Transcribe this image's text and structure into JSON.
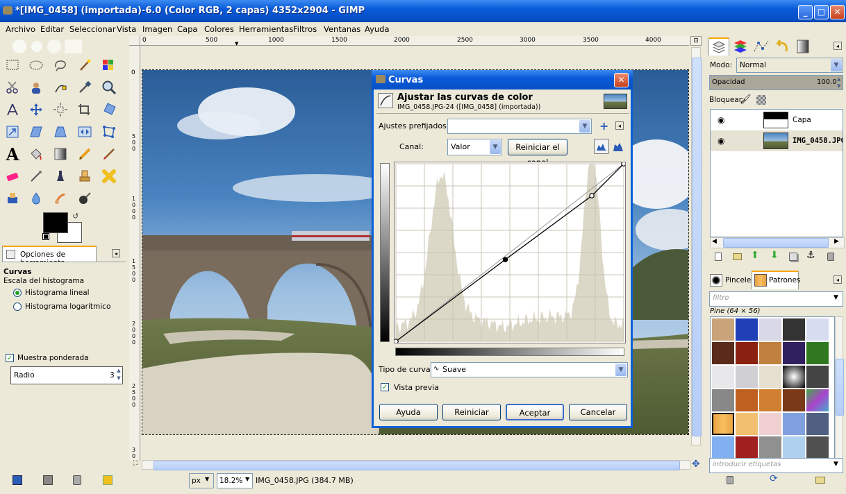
{
  "window": {
    "title": "*[IMG_0458] (importada)-6.0 (Color RGB, 2 capas) 4352x2904 - GIMP"
  },
  "menu": [
    "Archivo",
    "Editar",
    "Seleccionar",
    "Vista",
    "Imagen",
    "Capa",
    "Colores",
    "Herramientas",
    "Filtros",
    "Ventanas",
    "Ayuda"
  ],
  "ruler": {
    "top": [
      "0",
      "500",
      "1000",
      "1500",
      "2000",
      "2500",
      "3000",
      "3500",
      "4000"
    ],
    "left": [
      "0",
      "5 0 0",
      "1 0 0 0",
      "1 5 0 0",
      "2 0 0 0",
      "2 5 0 0",
      "3 0"
    ]
  },
  "tool_options": {
    "tab_label": "Opciones de herramienta",
    "heading": "Curvas",
    "histogram_scale_label": "Escala del histograma",
    "radio_linear": "Histograma lineal",
    "radio_log": "Histograma logarítmico",
    "weighted_label": "Muestra ponderada",
    "radius_label": "Radio",
    "radius_value": "3"
  },
  "curves_dialog": {
    "title": "Curvas",
    "heading": "Ajustar las curvas de color",
    "subheading": "IMG_0458.JPG-24 ([IMG_0458] (importada))",
    "presets_label": "Ajustes prefijados:",
    "presets_value": "",
    "channel_label": "Canal:",
    "channel_value": "Valor",
    "reset_channel": "Reiniciar el canal",
    "curve_type_label": "Tipo de curva:",
    "curve_type_value": "Suave",
    "preview_label": "Vista previa",
    "buttons": {
      "help": "Ayuda",
      "reset": "Reiniciar",
      "ok": "Aceptar",
      "cancel": "Cancelar"
    },
    "curve_points": [
      [
        0,
        0
      ],
      [
        0.48,
        0.46
      ],
      [
        0.86,
        0.82
      ],
      [
        1,
        1
      ]
    ]
  },
  "statusbar": {
    "unit": "px",
    "zoom": "18.2%",
    "info": "IMG_0458.JPG (384.7 MB)"
  },
  "layers": {
    "mode_label": "Modo:",
    "mode_value": "Normal",
    "opacity_label": "Opacidad",
    "opacity_value": "100.0",
    "lock_label": "Bloquear:",
    "items": [
      "Capa",
      "IMG_0458.JPG"
    ]
  },
  "patterns": {
    "tab_brushes": "Pinceles",
    "tab_patterns": "Patrones",
    "filter_placeholder": "filtro",
    "selected": "Pine (64 × 56)",
    "tags_placeholder": "introducir etiquetas"
  },
  "colors": {
    "accent": "#0a5ad8",
    "face": "#ece9d8"
  }
}
